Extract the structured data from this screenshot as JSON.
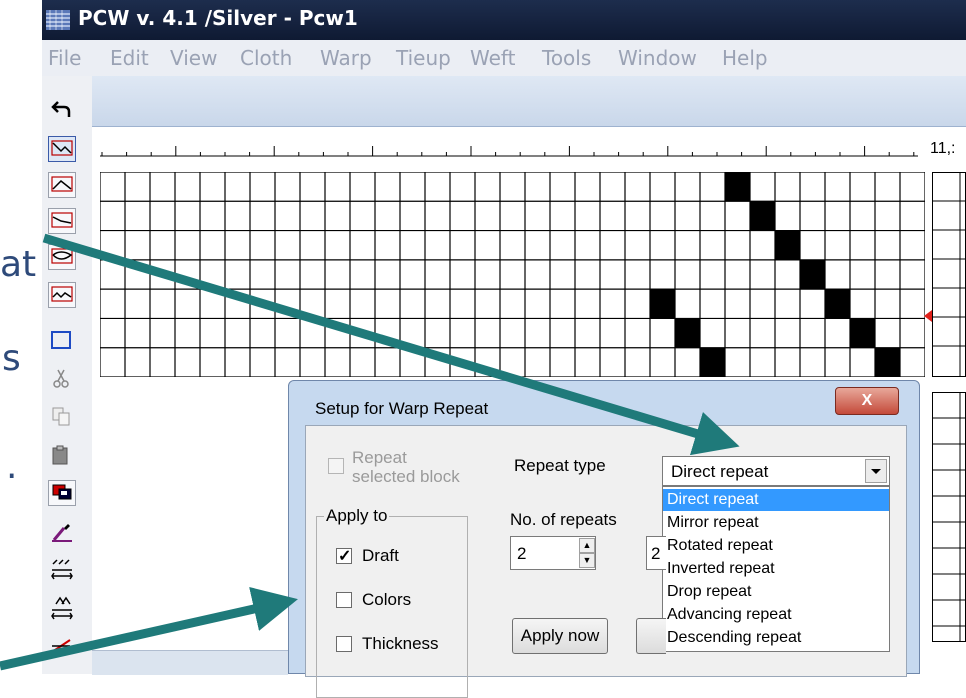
{
  "window": {
    "title": "PCW v. 4.1 /Silver - Pcw1"
  },
  "slide_fragments": [
    "at",
    "s",
    "."
  ],
  "menu": [
    "File",
    "Edit",
    "View",
    "Cloth",
    "Warp",
    "Tieup",
    "Weft",
    "Tools",
    "Window",
    "Help"
  ],
  "toolbar_icons": [
    "undo-icon",
    "pattern-tool-1-icon",
    "pattern-tool-2-icon",
    "pattern-tool-3-icon",
    "pattern-tool-4-icon",
    "pattern-tool-5-icon",
    "rectangle-select-icon",
    "cut-icon",
    "copy-icon",
    "paste-icon",
    "block-copy-icon",
    "eyedropper-icon",
    "warp-repeat-icon",
    "weft-repeat-icon",
    "erase-icon"
  ],
  "ruler": {
    "label": "11,:"
  },
  "draft_grid": {
    "cols": 29,
    "rows": 7,
    "filled": [
      [
        25,
        0
      ],
      [
        26,
        1
      ],
      [
        27,
        2
      ],
      [
        28,
        3
      ],
      [
        22,
        4
      ],
      [
        29,
        4
      ],
      [
        23,
        5
      ],
      [
        30,
        5
      ],
      [
        24,
        6
      ],
      [
        31,
        6
      ]
    ]
  },
  "dialog": {
    "title": "Setup for Warp Repeat",
    "close_label": "X",
    "repeat_selected_block": {
      "label_line1": "Repeat",
      "label_line2": "selected block",
      "checked": false,
      "disabled": true
    },
    "apply_to_label": "Apply to",
    "apply_to": [
      {
        "label": "Draft",
        "checked": true
      },
      {
        "label": "Colors",
        "checked": false
      },
      {
        "label": "Thickness",
        "checked": false
      }
    ],
    "repeat_type_label": "Repeat type",
    "repeat_type_value": "Direct repeat",
    "repeat_type_options": [
      "Direct repeat",
      "Mirror repeat",
      "Rotated repeat",
      "Inverted repeat",
      "Drop repeat",
      "Advancing repeat",
      "Descending repeat"
    ],
    "repeat_type_selected_index": 0,
    "no_of_repeats_label": "No. of repeats",
    "no_of_repeats_value": "2",
    "second_field_value": "2",
    "apply_now_label": "Apply now"
  },
  "colors": {
    "arrow": "#1f7a7a",
    "highlight": "#3399ff",
    "titlebar": "#14213d"
  }
}
